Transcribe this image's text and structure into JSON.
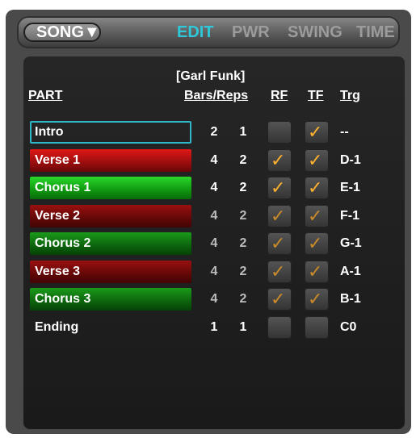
{
  "header": {
    "song_label": "SONG▼",
    "tabs": [
      {
        "label": "EDIT",
        "active": true
      },
      {
        "label": "PWR",
        "active": false
      },
      {
        "label": "SWING",
        "active": false
      },
      {
        "label": "TIME",
        "active": false
      }
    ]
  },
  "song_name": "[Garl Funk]",
  "columns": {
    "part": "PART",
    "bars_reps": "Bars/Reps",
    "rf": "RF",
    "tf": "TF",
    "trg": "Trg"
  },
  "rows": [
    {
      "name": "Intro",
      "bars": "2",
      "reps": "1",
      "rf": false,
      "tf": true,
      "trg": "--",
      "style": "intro"
    },
    {
      "name": "Verse 1",
      "bars": "4",
      "reps": "2",
      "rf": true,
      "tf": true,
      "trg": "D-1",
      "style": "red"
    },
    {
      "name": "Chorus 1",
      "bars": "4",
      "reps": "2",
      "rf": true,
      "tf": true,
      "trg": "E-1",
      "style": "green"
    },
    {
      "name": "Verse 2",
      "bars": "4",
      "reps": "2",
      "rf": true,
      "tf": true,
      "trg": "F-1",
      "style": "red dim"
    },
    {
      "name": "Chorus 2",
      "bars": "4",
      "reps": "2",
      "rf": true,
      "tf": true,
      "trg": "G-1",
      "style": "green dim"
    },
    {
      "name": "Verse 3",
      "bars": "4",
      "reps": "2",
      "rf": true,
      "tf": true,
      "trg": "A-1",
      "style": "red dim"
    },
    {
      "name": "Chorus 3",
      "bars": "4",
      "reps": "2",
      "rf": true,
      "tf": true,
      "trg": "B-1",
      "style": "green dim"
    },
    {
      "name": "Ending",
      "bars": "1",
      "reps": "1",
      "rf": false,
      "tf": false,
      "trg": "C0",
      "style": "plain"
    }
  ],
  "colors": {
    "accent": "#2ec8d8",
    "check": "#ffb02e",
    "verse": "#c01010",
    "chorus": "#18b018"
  },
  "icons": {
    "check": "checkmark-icon",
    "dropdown": "triangle-down-icon"
  }
}
